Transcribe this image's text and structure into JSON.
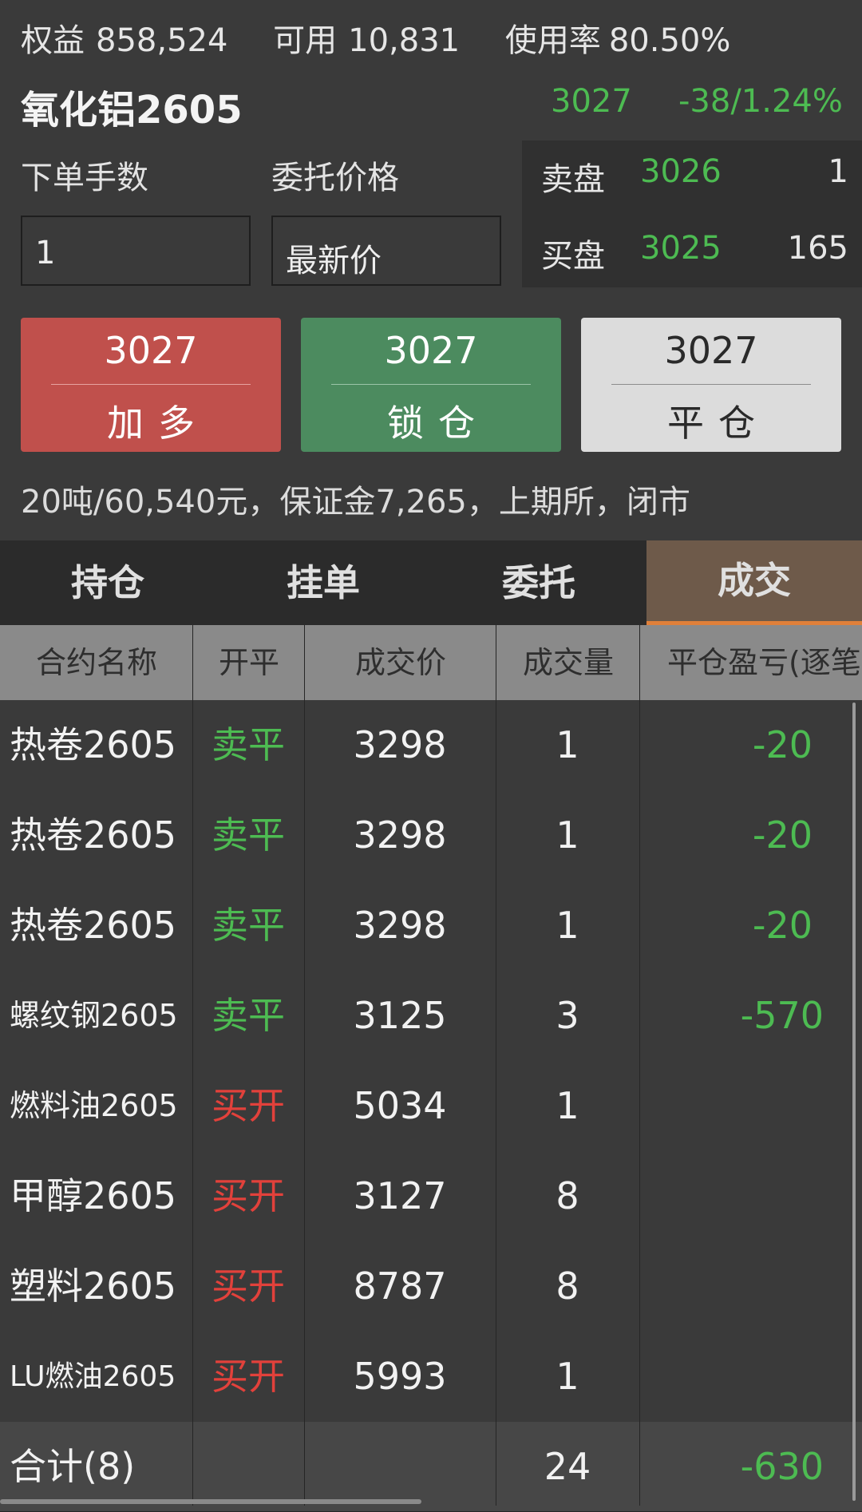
{
  "account": {
    "equity_label": "权益",
    "equity_value": "858,524",
    "available_label": "可用",
    "available_value": "10,831",
    "usage_label": "使用率",
    "usage_value": "80.50%"
  },
  "contract": {
    "name": "氧化铝2605",
    "last_price": "3027",
    "change": "-38/1.24%"
  },
  "order_form": {
    "lots_label": "下单手数",
    "lots_value": "1",
    "price_label": "委托价格",
    "price_value": "最新价"
  },
  "order_book": {
    "ask_label": "卖盘",
    "ask_price": "3026",
    "ask_volume": "1",
    "bid_label": "买盘",
    "bid_price": "3025",
    "bid_volume": "165"
  },
  "actions": {
    "long_price": "3027",
    "long_label": "加多",
    "lock_price": "3027",
    "lock_label": "锁仓",
    "close_price": "3027",
    "close_label": "平仓"
  },
  "info_line": "20吨/60,540元，保证金7,265，上期所，闭市",
  "tabs": [
    "持仓",
    "挂单",
    "委托",
    "成交"
  ],
  "active_tab": "成交",
  "table": {
    "headers": [
      "合约名称",
      "开平",
      "成交价",
      "成交量",
      "平仓盈亏(逐笔)"
    ],
    "rows": [
      {
        "name": "热卷2605",
        "oc": "卖平",
        "oc_color": "#4dbb52",
        "price": "3298",
        "qty": "1",
        "pl": "-20"
      },
      {
        "name": "热卷2605",
        "oc": "卖平",
        "oc_color": "#4dbb52",
        "price": "3298",
        "qty": "1",
        "pl": "-20"
      },
      {
        "name": "热卷2605",
        "oc": "卖平",
        "oc_color": "#4dbb52",
        "price": "3298",
        "qty": "1",
        "pl": "-20"
      },
      {
        "name": "螺纹钢2605",
        "oc": "卖平",
        "oc_color": "#4dbb52",
        "price": "3125",
        "qty": "3",
        "pl": "-570"
      },
      {
        "name": "燃料油2605",
        "oc": "买开",
        "oc_color": "#e2413b",
        "price": "5034",
        "qty": "1",
        "pl": ""
      },
      {
        "name": "甲醇2605",
        "oc": "买开",
        "oc_color": "#e2413b",
        "price": "3127",
        "qty": "8",
        "pl": ""
      },
      {
        "name": "塑料2605",
        "oc": "买开",
        "oc_color": "#e2413b",
        "price": "8787",
        "qty": "8",
        "pl": ""
      },
      {
        "name": "LU燃油2605",
        "oc": "买开",
        "oc_color": "#e2413b",
        "price": "5993",
        "qty": "1",
        "pl": ""
      }
    ],
    "total": {
      "label": "合计(8)",
      "qty": "24",
      "pl": "-630"
    }
  },
  "colors": {
    "up": "#e2413b",
    "down": "#4dbb52",
    "active_tab_accent": "#e0803a"
  }
}
